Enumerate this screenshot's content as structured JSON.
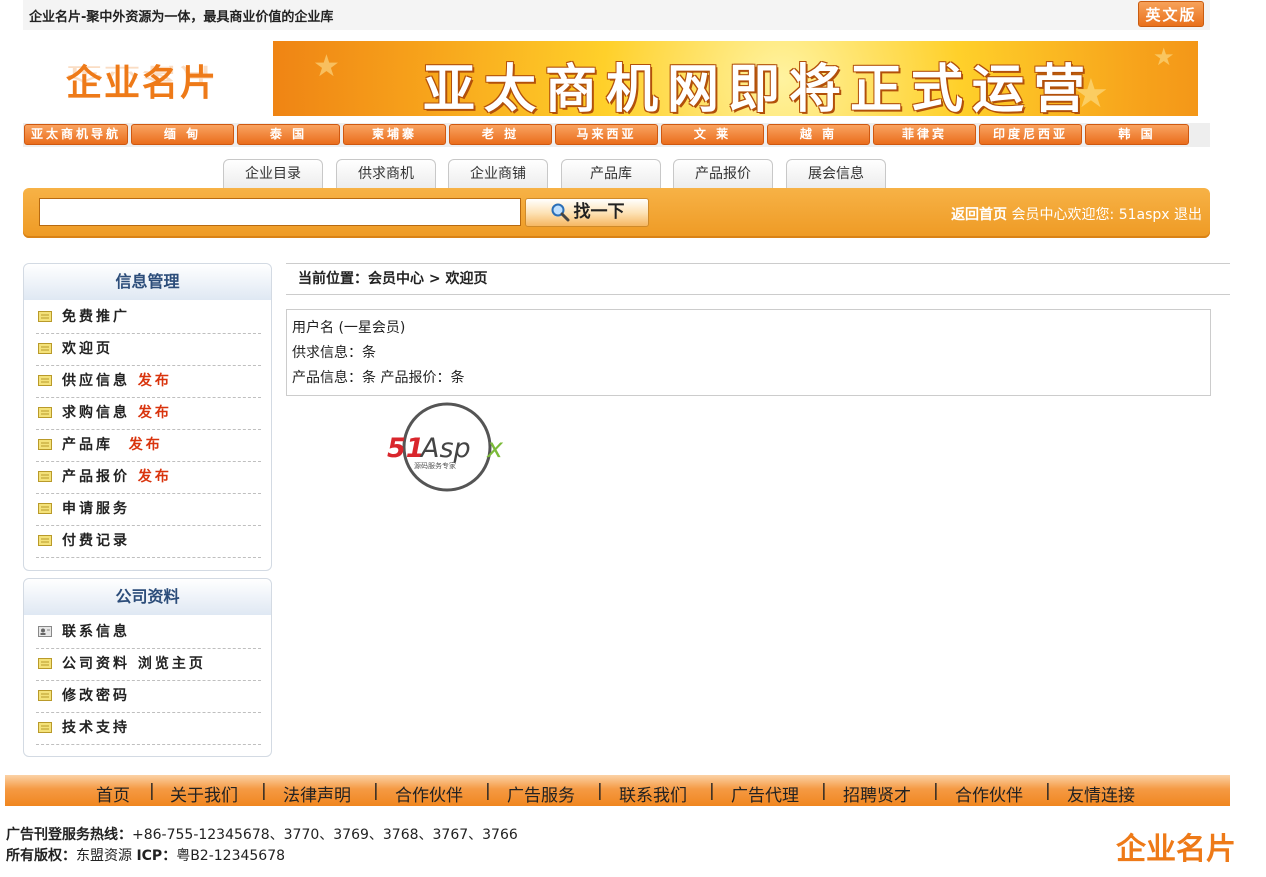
{
  "topbar": {
    "slogan": "企业名片-聚中外资源为一体，最具商业价值的企业库",
    "english": "英文版"
  },
  "logo": "企业名片",
  "banner": "亚太商机网即将正式运营",
  "nav": [
    "亚太商机导航",
    "缅 甸",
    "泰 国",
    "柬埔寨",
    "老 挝",
    "马来西亚",
    "文 莱",
    "越 南",
    "菲律宾",
    "印度尼西亚",
    "韩 国"
  ],
  "tabs": [
    "企业目录",
    "供求商机",
    "企业商铺",
    "产品库",
    "产品报价",
    "展会信息"
  ],
  "search": {
    "value": "",
    "button": "找一下"
  },
  "userbar": {
    "home": "返回首页",
    "center": "会员中心",
    "welcome": "欢迎您:",
    "user": "51aspx",
    "logout": "退出"
  },
  "sidebar": {
    "info": {
      "title": "信息管理",
      "items": [
        {
          "label": "免费推广"
        },
        {
          "label": "欢迎页"
        },
        {
          "label": "供应信息",
          "action": "发布"
        },
        {
          "label": "求购信息",
          "action": "发布"
        },
        {
          "label": "产品库",
          "action": "发布"
        },
        {
          "label": "产品报价",
          "action": "发布"
        },
        {
          "label": "申请服务"
        },
        {
          "label": "付费记录"
        }
      ]
    },
    "company": {
      "title": "公司资料",
      "items": [
        {
          "label": "联系信息"
        },
        {
          "label": "公司资料",
          "action": "浏览主页"
        },
        {
          "label": "修改密码"
        },
        {
          "label": "技术支持"
        }
      ]
    }
  },
  "breadcrumb": "当前位置：会员中心 > 欢迎页",
  "info": {
    "line1": "用户名 (一星会员)",
    "line2": "供求信息：条",
    "line3": "产品信息：条 产品报价：条"
  },
  "watermark": {
    "brand": "51Aspx",
    "tagline": "源码服务专家"
  },
  "footer": {
    "links": [
      "首页",
      "关于我们",
      "法律声明",
      "合作伙伴",
      "广告服务",
      "联系我们",
      "广告代理",
      "招聘贤才",
      "合作伙伴",
      "友情连接"
    ],
    "hotline_label": "广告刊登服务热线：",
    "hotline": "+86-755-12345678、3770、3769、3768、3767、3766",
    "copyright_label": "所有版权：",
    "copyright": "东盟资源",
    "icp_label": "ICP：",
    "icp": "粤B2-12345678",
    "logo": "企业名片"
  },
  "colors": {
    "accent": "#ee9a24",
    "nav": "#ea6d1c",
    "link_red": "#d9330c",
    "sidebar_title": "#2c4d7a"
  }
}
